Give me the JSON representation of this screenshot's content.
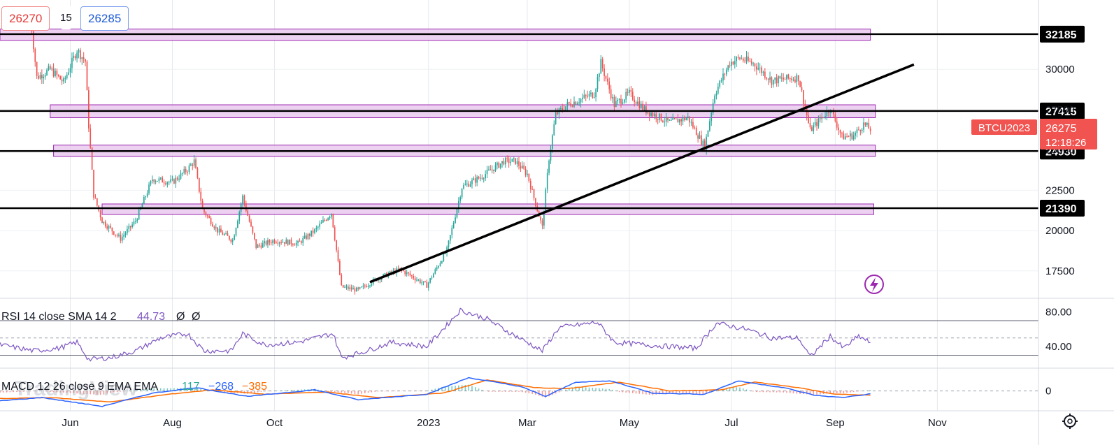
{
  "symbol": "BTCU2023",
  "quote": {
    "bid": "26270",
    "spread": "15",
    "ask": "26285",
    "last": "26275",
    "countdown": "12:18:26"
  },
  "watermark": "TradingView",
  "colors": {
    "up": "#26a69a",
    "down": "#ef5350",
    "zone_fill": "#e9c9ee",
    "zone_border": "#9c27b0",
    "level_line": "#000000",
    "rsi": "#7e57c2",
    "macd": "#2962ff",
    "signal": "#ff6d00"
  },
  "icons": {
    "lightning": "lightning-icon",
    "settings": "gear-icon"
  },
  "chart_data": [
    {
      "type": "candlestick",
      "pane": "price",
      "x_range": [
        "2022-04-20",
        "2023-12-31"
      ],
      "ylim": [
        15800,
        34300
      ],
      "y_ticks": [
        "30000",
        "27500",
        "25000",
        "22500",
        "20000",
        "17500"
      ],
      "x_ticks": [
        {
          "label": "Jun",
          "date": "2022-06-01"
        },
        {
          "label": "Aug",
          "date": "2022-08-01"
        },
        {
          "label": "Oct",
          "date": "2022-10-01"
        },
        {
          "label": "2023",
          "date": "2023-01-01"
        },
        {
          "label": "Mar",
          "date": "2023-03-01"
        },
        {
          "label": "May",
          "date": "2023-05-01"
        },
        {
          "label": "Jul",
          "date": "2023-07-01"
        },
        {
          "label": "Sep",
          "date": "2023-09-01"
        },
        {
          "label": "Nov",
          "date": "2023-11-01"
        }
      ],
      "price_path": [
        [
          "2022-05-08",
          33500
        ],
        [
          "2022-05-12",
          29500
        ],
        [
          "2022-05-20",
          30000
        ],
        [
          "2022-05-28",
          29200
        ],
        [
          "2022-06-05",
          31200
        ],
        [
          "2022-06-10",
          30500
        ],
        [
          "2022-06-12",
          26500
        ],
        [
          "2022-06-15",
          22200
        ],
        [
          "2022-06-20",
          20600
        ],
        [
          "2022-07-01",
          19500
        ],
        [
          "2022-07-10",
          20600
        ],
        [
          "2022-07-20",
          23200
        ],
        [
          "2022-08-01",
          23000
        ],
        [
          "2022-08-10",
          23800
        ],
        [
          "2022-08-14",
          24300
        ],
        [
          "2022-08-19",
          21300
        ],
        [
          "2022-08-28",
          20000
        ],
        [
          "2022-09-06",
          19400
        ],
        [
          "2022-09-12",
          22100
        ],
        [
          "2022-09-20",
          19000
        ],
        [
          "2022-10-01",
          19400
        ],
        [
          "2022-10-15",
          19200
        ],
        [
          "2022-10-25",
          20000
        ],
        [
          "2022-11-04",
          21100
        ],
        [
          "2022-11-08",
          18000
        ],
        [
          "2022-11-10",
          16500
        ],
        [
          "2022-11-20",
          16300
        ],
        [
          "2022-12-01",
          17000
        ],
        [
          "2022-12-15",
          17600
        ],
        [
          "2022-12-31",
          16600
        ],
        [
          "2023-01-12",
          18800
        ],
        [
          "2023-01-21",
          22700
        ],
        [
          "2023-02-01",
          23300
        ],
        [
          "2023-02-15",
          24300
        ],
        [
          "2023-02-22",
          24300
        ],
        [
          "2023-03-01",
          23500
        ],
        [
          "2023-03-10",
          20200
        ],
        [
          "2023-03-14",
          24500
        ],
        [
          "2023-03-18",
          27200
        ],
        [
          "2023-03-25",
          27800
        ],
        [
          "2023-04-10",
          28500
        ],
        [
          "2023-04-14",
          30400
        ],
        [
          "2023-04-22",
          27800
        ],
        [
          "2023-05-01",
          28500
        ],
        [
          "2023-05-10",
          27500
        ],
        [
          "2023-05-25",
          26700
        ],
        [
          "2023-06-05",
          27000
        ],
        [
          "2023-06-15",
          25200
        ],
        [
          "2023-06-21",
          28500
        ],
        [
          "2023-06-30",
          30400
        ],
        [
          "2023-07-06",
          30700
        ],
        [
          "2023-07-15",
          30300
        ],
        [
          "2023-07-25",
          29300
        ],
        [
          "2023-08-10",
          29500
        ],
        [
          "2023-08-17",
          26200
        ],
        [
          "2023-08-29",
          27600
        ],
        [
          "2023-09-05",
          25800
        ],
        [
          "2023-09-12",
          25900
        ],
        [
          "2023-09-18",
          26600
        ],
        [
          "2023-09-22",
          26275
        ]
      ],
      "horizontal_levels": [
        {
          "value": 32185,
          "label": "32185"
        },
        {
          "value": 27415,
          "label": "27415"
        },
        {
          "value": 24930,
          "label": "24930"
        },
        {
          "value": 21390,
          "label": "21390"
        }
      ],
      "zones": [
        {
          "from_date": "2022-04-20",
          "to_date": "2023-09-22",
          "low": 31800,
          "high": 32500
        },
        {
          "from_date": "2022-05-20",
          "to_date": "2023-09-25",
          "low": 27000,
          "high": 27800
        },
        {
          "from_date": "2022-05-22",
          "to_date": "2023-09-25",
          "low": 24600,
          "high": 25300
        },
        {
          "from_date": "2022-06-20",
          "to_date": "2023-09-24",
          "low": 21000,
          "high": 21650
        }
      ],
      "trendline": {
        "from": [
          "2022-11-27",
          16800
        ],
        "to": [
          "2023-10-18",
          30300
        ]
      },
      "last_price": 26275
    },
    {
      "type": "line",
      "pane": "rsi",
      "label": "RSI 14 close SMA 14 2",
      "value": "44.73",
      "na": [
        "Ø",
        "Ø"
      ],
      "ylim": [
        15,
        95
      ],
      "y_ticks": [
        "80.00",
        "40.00"
      ],
      "bands": [
        70,
        30,
        50
      ],
      "points": [
        [
          "2022-04-20",
          42
        ],
        [
          "2022-05-10",
          35
        ],
        [
          "2022-05-25",
          38
        ],
        [
          "2022-06-05",
          45
        ],
        [
          "2022-06-12",
          25
        ],
        [
          "2022-06-25",
          27
        ],
        [
          "2022-07-10",
          35
        ],
        [
          "2022-07-25",
          50
        ],
        [
          "2022-08-10",
          55
        ],
        [
          "2022-08-20",
          35
        ],
        [
          "2022-09-05",
          35
        ],
        [
          "2022-09-12",
          55
        ],
        [
          "2022-09-25",
          42
        ],
        [
          "2022-10-15",
          45
        ],
        [
          "2022-11-05",
          55
        ],
        [
          "2022-11-10",
          27
        ],
        [
          "2022-11-25",
          35
        ],
        [
          "2022-12-10",
          45
        ],
        [
          "2022-12-31",
          40
        ],
        [
          "2023-01-12",
          65
        ],
        [
          "2023-01-20",
          82
        ],
        [
          "2023-02-05",
          72
        ],
        [
          "2023-02-15",
          60
        ],
        [
          "2023-03-10",
          35
        ],
        [
          "2023-03-20",
          62
        ],
        [
          "2023-04-12",
          68
        ],
        [
          "2023-04-22",
          45
        ],
        [
          "2023-05-10",
          42
        ],
        [
          "2023-06-10",
          38
        ],
        [
          "2023-06-22",
          67
        ],
        [
          "2023-07-10",
          60
        ],
        [
          "2023-07-25",
          50
        ],
        [
          "2023-08-10",
          50
        ],
        [
          "2023-08-17",
          28
        ],
        [
          "2023-08-29",
          52
        ],
        [
          "2023-09-06",
          38
        ],
        [
          "2023-09-15",
          52
        ],
        [
          "2023-09-22",
          44.73
        ]
      ]
    },
    {
      "type": "line",
      "pane": "macd",
      "label": "MACD 12 26 close 9 EMA EMA",
      "values": [
        "117",
        "−268",
        "−385"
      ],
      "ylim": [
        -1800,
        2000
      ],
      "y_ticks": [
        "0"
      ],
      "macd": [
        [
          "2022-04-20",
          -900
        ],
        [
          "2022-05-15",
          -600
        ],
        [
          "2022-06-20",
          -1400
        ],
        [
          "2022-07-20",
          -200
        ],
        [
          "2022-08-15",
          300
        ],
        [
          "2022-09-15",
          -500
        ],
        [
          "2022-10-25",
          100
        ],
        [
          "2022-11-20",
          -800
        ],
        [
          "2022-12-31",
          -300
        ],
        [
          "2023-01-25",
          1200
        ],
        [
          "2023-02-25",
          400
        ],
        [
          "2023-03-12",
          -500
        ],
        [
          "2023-03-30",
          800
        ],
        [
          "2023-04-20",
          900
        ],
        [
          "2023-05-15",
          -200
        ],
        [
          "2023-06-15",
          -300
        ],
        [
          "2023-07-05",
          900
        ],
        [
          "2023-08-01",
          300
        ],
        [
          "2023-08-20",
          -400
        ],
        [
          "2023-09-05",
          -600
        ],
        [
          "2023-09-22",
          -268
        ]
      ],
      "signal": [
        [
          "2022-04-20",
          -700
        ],
        [
          "2022-05-20",
          -600
        ],
        [
          "2022-06-25",
          -1000
        ],
        [
          "2022-07-30",
          -300
        ],
        [
          "2022-08-25",
          100
        ],
        [
          "2022-09-25",
          -300
        ],
        [
          "2022-11-01",
          -100
        ],
        [
          "2022-12-01",
          -600
        ],
        [
          "2023-01-10",
          -200
        ],
        [
          "2023-02-05",
          1000
        ],
        [
          "2023-03-05",
          300
        ],
        [
          "2023-03-25",
          200
        ],
        [
          "2023-04-25",
          800
        ],
        [
          "2023-05-25",
          0
        ],
        [
          "2023-06-25",
          100
        ],
        [
          "2023-07-15",
          800
        ],
        [
          "2023-08-10",
          300
        ],
        [
          "2023-09-01",
          -300
        ],
        [
          "2023-09-22",
          -385
        ]
      ]
    }
  ]
}
